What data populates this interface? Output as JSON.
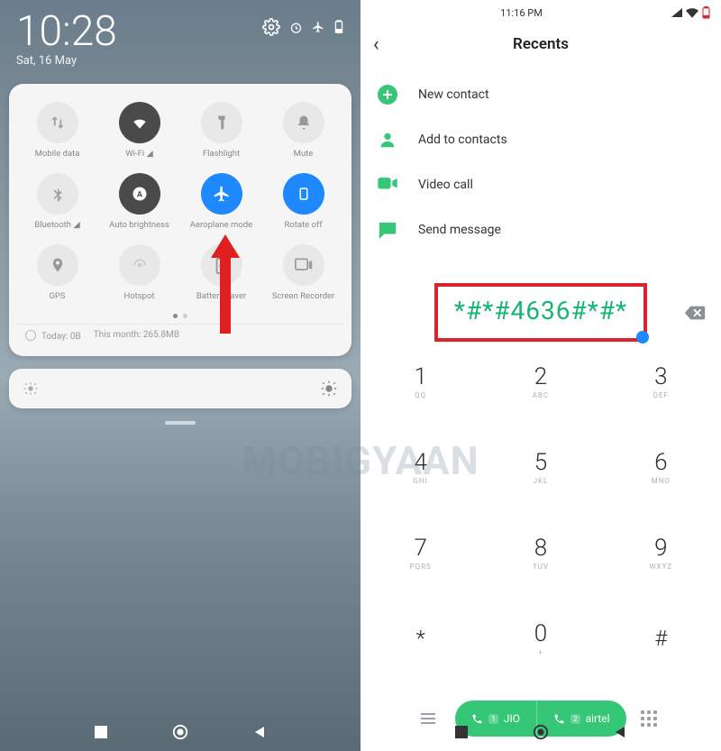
{
  "watermark": "MOBIGYAAN",
  "left": {
    "time": "10:28",
    "date": "Sat, 16 May",
    "tiles": [
      {
        "label": "Mobile data",
        "icon": "data-swap",
        "state": "off"
      },
      {
        "label": "Wi-Fi ◢",
        "icon": "wifi",
        "state": "dark"
      },
      {
        "label": "Flashlight",
        "icon": "flashlight",
        "state": "off"
      },
      {
        "label": "Mute",
        "icon": "bell",
        "state": "off"
      },
      {
        "label": "Bluetooth ◢",
        "icon": "bluetooth",
        "state": "off"
      },
      {
        "label": "Auto brightness",
        "icon": "auto-bright",
        "state": "dark"
      },
      {
        "label": "Aeroplane mode",
        "icon": "airplane",
        "state": "active"
      },
      {
        "label": "Rotate off",
        "icon": "rotate",
        "state": "active"
      },
      {
        "label": "GPS",
        "icon": "gps",
        "state": "off"
      },
      {
        "label": "Hotspot",
        "icon": "hotspot",
        "state": "off"
      },
      {
        "label": "Battery saver",
        "icon": "battery-saver",
        "state": "off"
      },
      {
        "label": "Screen Recorder",
        "icon": "screen-record",
        "state": "off"
      }
    ],
    "data_today": "Today: 0B",
    "data_month": "This month: 265.8MB"
  },
  "right": {
    "status_time": "11:16 PM",
    "header_title": "Recents",
    "options": [
      {
        "label": "New contact",
        "icon": "plus-circle",
        "color": "#35c678"
      },
      {
        "label": "Add to contacts",
        "icon": "person",
        "color": "#35c678"
      },
      {
        "label": "Video call",
        "icon": "video",
        "color": "#35c678"
      },
      {
        "label": "Send message",
        "icon": "message",
        "color": "#35c678"
      }
    ],
    "dialed_number": "*#*#4636#*#*",
    "keys": [
      {
        "n": "1",
        "s": "QQ"
      },
      {
        "n": "2",
        "s": "ABC"
      },
      {
        "n": "3",
        "s": "DEF"
      },
      {
        "n": "4",
        "s": "GHI"
      },
      {
        "n": "5",
        "s": "JKL"
      },
      {
        "n": "6",
        "s": "MNO"
      },
      {
        "n": "7",
        "s": "PQRS"
      },
      {
        "n": "8",
        "s": "TUV"
      },
      {
        "n": "9",
        "s": "WXYZ"
      },
      {
        "n": "*",
        "s": ""
      },
      {
        "n": "0",
        "s": "+"
      },
      {
        "n": "#",
        "s": ""
      }
    ],
    "sim1": {
      "badge": "1",
      "label": "JIO"
    },
    "sim2": {
      "badge": "2",
      "label": "airtel"
    }
  }
}
